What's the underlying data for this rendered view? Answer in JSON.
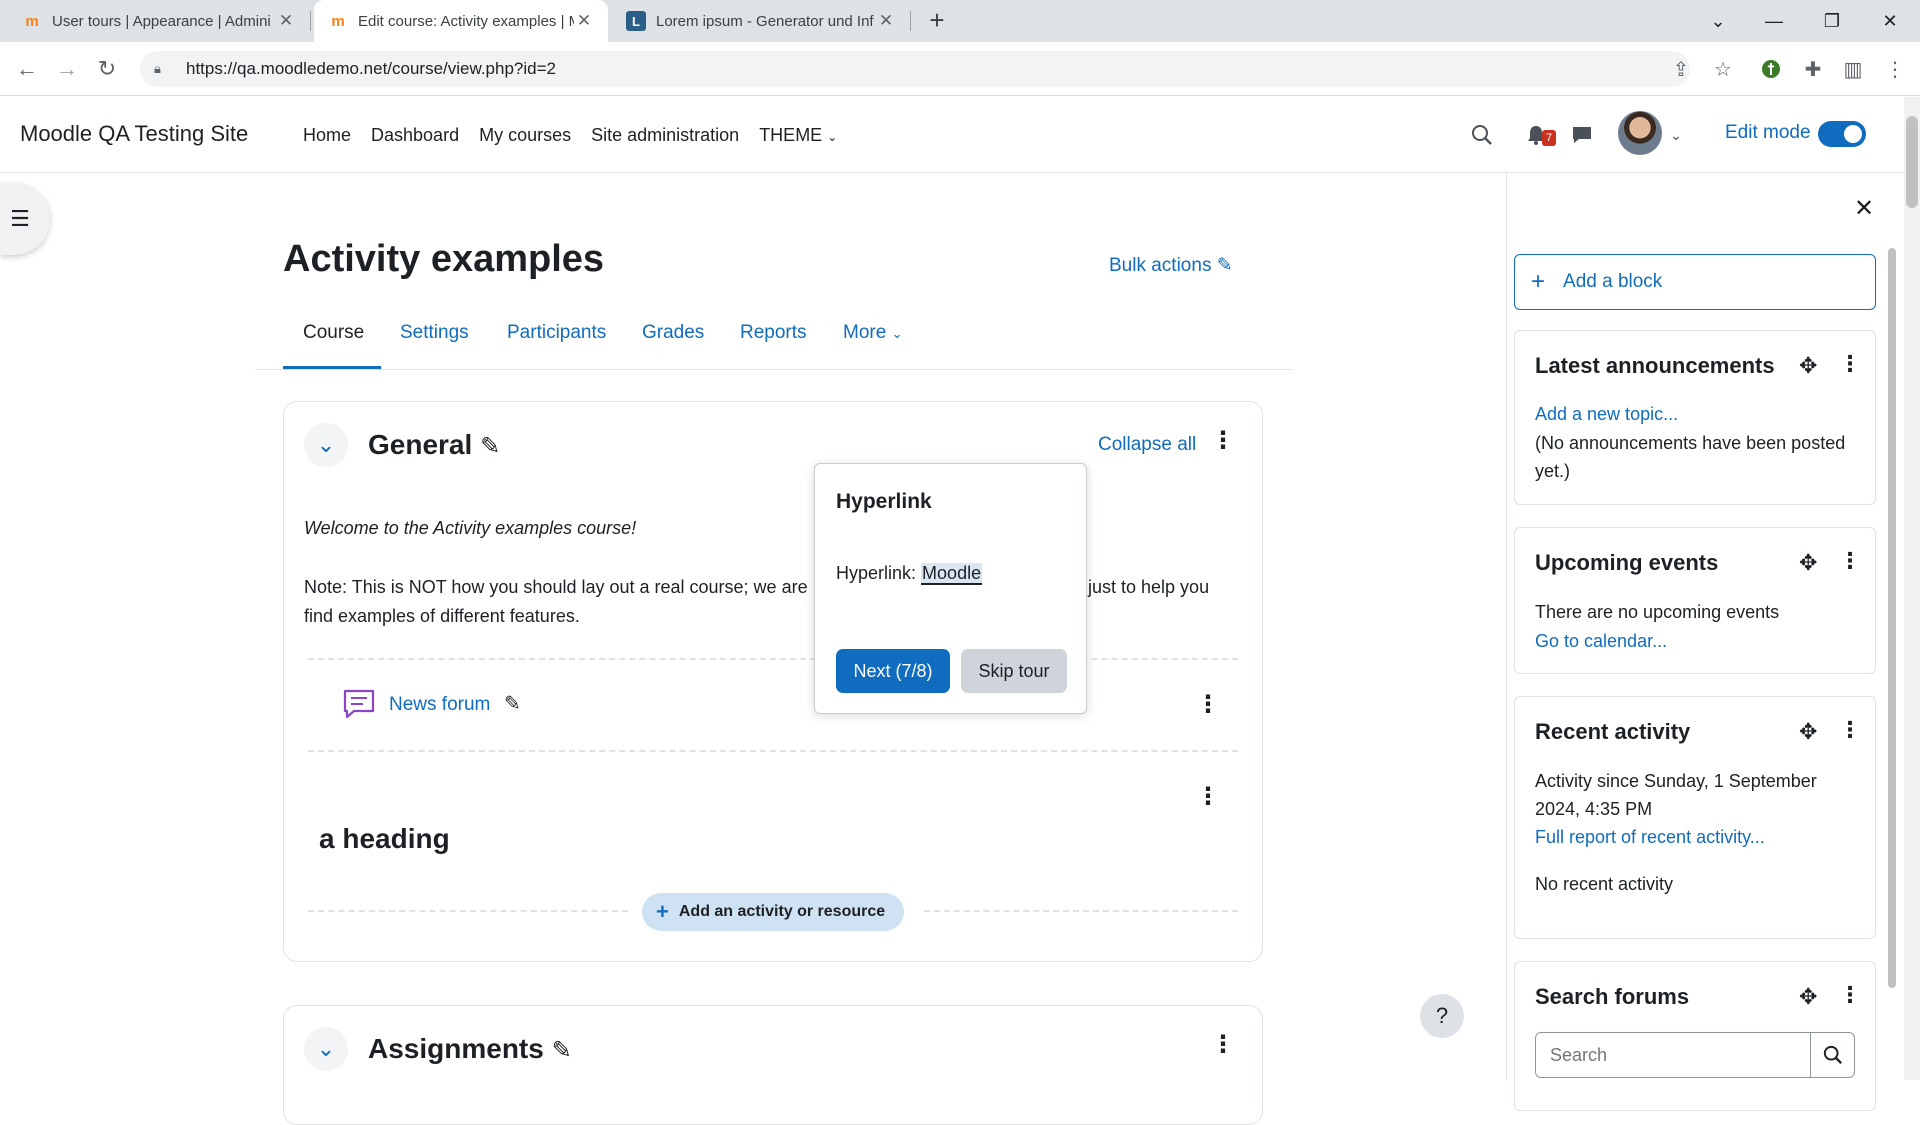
{
  "browser": {
    "tabs": [
      {
        "title": "User tours | Appearance | Admini",
        "favicon": "m"
      },
      {
        "title": "Edit course: Activity examples | M",
        "favicon": "m"
      },
      {
        "title": "Lorem ipsum - Generator und Inf",
        "favicon": "L"
      }
    ],
    "url": "https://qa.moodledemo.net/course/view.php?id=2"
  },
  "navbar": {
    "site_name": "Moodle QA Testing Site",
    "links": [
      "Home",
      "Dashboard",
      "My courses",
      "Site administration",
      "THEME"
    ],
    "notification_count": "7",
    "edit_mode_label": "Edit mode",
    "edit_mode_on": true
  },
  "page": {
    "title": "Activity examples",
    "bulk_actions": "Bulk actions",
    "secondary_nav": [
      "Course",
      "Settings",
      "Participants",
      "Grades",
      "Reports",
      "More"
    ],
    "active_tab": "Course"
  },
  "general_section": {
    "title": "General",
    "collapse_all": "Collapse all",
    "welcome": "Welcome to the Activity examples course!",
    "note_start": "Note: This is NOT how you should lay out a real course; we are",
    "note_end": "just to help you",
    "note_line2": "find examples of different features.",
    "forum_link": "News forum",
    "heading": "a heading",
    "add_activity": "Add an activity or resource"
  },
  "assignments_section": {
    "title": "Assignments"
  },
  "tour": {
    "title": "Hyperlink",
    "body_label": "Hyperlink:",
    "body_link": "Moodle",
    "next": "Next (7/8)",
    "skip": "Skip tour"
  },
  "drawer": {
    "add_block": "Add a block",
    "latest": {
      "title": "Latest announcements",
      "link": "Add a new topic...",
      "text": "(No announcements have been posted yet.)"
    },
    "upcoming": {
      "title": "Upcoming events",
      "text": "There are no upcoming events",
      "link": "Go to calendar..."
    },
    "recent": {
      "title": "Recent activity",
      "text": "Activity since Sunday, 1 September 2024, 4:35 PM",
      "link": "Full report of recent activity...",
      "none": "No recent activity"
    },
    "search": {
      "title": "Search forums",
      "placeholder": "Search"
    }
  },
  "colors": {
    "brand": "#0f6cbf",
    "badge": "#ca3120",
    "add_activity_bg": "#cfe2f3"
  }
}
